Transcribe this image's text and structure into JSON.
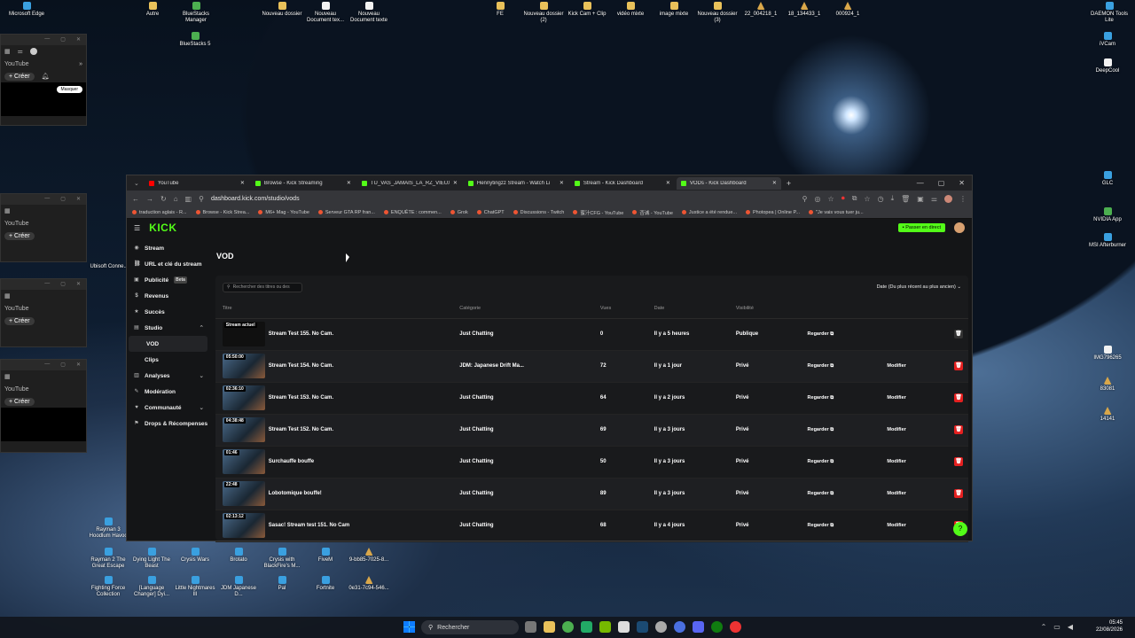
{
  "desktop_icons_top": [
    {
      "label": "Microsoft Edge",
      "type": "app"
    },
    {
      "label": "Autre",
      "type": "folder"
    },
    {
      "label": "BlueStacks Manager",
      "type": "green"
    },
    {
      "label": "Nouveau dossier",
      "type": "folder"
    },
    {
      "label": "Nouveau Document tex...",
      "type": "doc"
    },
    {
      "label": "Nouveau Document texte",
      "type": "doc"
    },
    {
      "label": "FE",
      "type": "folder"
    },
    {
      "label": "Nouveau dossier (2)",
      "type": "folder"
    },
    {
      "label": "Kick Cam + Clip",
      "type": "folder"
    },
    {
      "label": "vidéo mixte",
      "type": "folder"
    },
    {
      "label": "image mixte",
      "type": "folder"
    },
    {
      "label": "Nouveau dossier (3)",
      "type": "folder"
    },
    {
      "label": "22_004218_1",
      "type": "warn"
    },
    {
      "label": "18_134433_1",
      "type": "warn"
    },
    {
      "label": "000924_1",
      "type": "warn"
    },
    {
      "label": "DAEMON Tools Lite",
      "type": "app"
    }
  ],
  "desktop_icons_right": [
    {
      "label": "iVCam",
      "type": "app"
    },
    {
      "label": "DeepCool",
      "type": "doc"
    },
    {
      "label": "GLC",
      "type": "app"
    },
    {
      "label": "NVIDIA App",
      "type": "green"
    },
    {
      "label": "MSI Afterburner",
      "type": "app"
    },
    {
      "label": "IMG796265",
      "type": "doc"
    },
    {
      "label": "83081",
      "type": "warn"
    },
    {
      "label": "14141",
      "type": "warn"
    }
  ],
  "desktop_icons_bottom": [
    {
      "label": "Rayman 3 Hoodlum Havoc",
      "type": "app"
    },
    {
      "label": "Rayman 2 The Great Escape",
      "type": "app"
    },
    {
      "label": "Dying Light The Beast",
      "type": "app"
    },
    {
      "label": "Crysis Wars",
      "type": "app"
    },
    {
      "label": "Brotato",
      "type": "app"
    },
    {
      "label": "Crysis with BlackFire's M...",
      "type": "app"
    },
    {
      "label": "FiveM",
      "type": "app"
    },
    {
      "label": "9-bb85-7025-8...",
      "type": "warn"
    },
    {
      "label": "Fighting Force Collection",
      "type": "app"
    },
    {
      "label": "[Language Changer] Dyi...",
      "type": "app"
    },
    {
      "label": "Little Nightmares III",
      "type": "app"
    },
    {
      "label": "JDM Japanese D...",
      "type": "app"
    },
    {
      "label": "Pal",
      "type": "app"
    },
    {
      "label": "Fortnite",
      "type": "app"
    },
    {
      "label": "0e31-7c94-546...",
      "type": "warn"
    }
  ],
  "desktop_misc": {
    "bluestacks5": "BlueStacks 5",
    "ubisoft": "Ubisoft Conne..."
  },
  "mini_windows": {
    "tab": "YouTube",
    "create": "Créer",
    "hide": "Masquer"
  },
  "browser": {
    "tabs": [
      {
        "label": "YouTube",
        "color": "#ff0000"
      },
      {
        "label": "Browse - Kick Streaming",
        "color": "#53fc18"
      },
      {
        "label": "TU_VAS_JAMAIS_LA_RZ_VIEUX",
        "color": "#53fc18"
      },
      {
        "label": "Hennytingzz Stream - Watch Li",
        "color": "#53fc18"
      },
      {
        "label": "Stream - Kick Dashboard",
        "color": "#53fc18"
      },
      {
        "label": "VODs - Kick Dashboard",
        "color": "#53fc18"
      }
    ],
    "url": "dashboard.kick.com/studio/vods",
    "bookmarks": [
      "traduction aglais - R...",
      "Browse - Kick Strea...",
      "M6+ Mag - YouTube",
      "Serveur GTA RP fran...",
      "ENQUÊTE : commen...",
      "Grok",
      "ChatGPT",
      "Discussions - Twitch",
      "蜜汁CFG - YouTube",
      "否诚 - YouTube",
      "Justice a été rendue...",
      "Photopea | Online P...",
      "\"Je vais vous tuer ju..."
    ]
  },
  "kick": {
    "logo": "KICK",
    "go_live": "Passer en direct",
    "sidebar": [
      {
        "label": "Stream",
        "icon": "◉",
        "active": false,
        "sub": false
      },
      {
        "label": "URL et clé du stream",
        "icon": "⛓",
        "active": false,
        "sub": false
      },
      {
        "label": "Publicité",
        "icon": "▣",
        "active": false,
        "sub": false,
        "badge": "Beta"
      },
      {
        "label": "Revenus",
        "icon": "$",
        "active": false,
        "sub": false
      },
      {
        "label": "Succès",
        "icon": "★",
        "active": false,
        "sub": false
      },
      {
        "label": "Studio",
        "icon": "▤",
        "active": false,
        "sub": false,
        "chev": "⌃"
      },
      {
        "label": "VOD",
        "icon": "",
        "active": true,
        "sub": true
      },
      {
        "label": "Clips",
        "icon": "",
        "active": false,
        "sub": true
      },
      {
        "label": "Analyses",
        "icon": "▥",
        "active": false,
        "sub": false,
        "chev": "⌄"
      },
      {
        "label": "Modération",
        "icon": "✎",
        "active": false,
        "sub": false
      },
      {
        "label": "Communauté",
        "icon": "♥",
        "active": false,
        "sub": false,
        "chev": "⌄"
      },
      {
        "label": "Drops & Récompenses",
        "icon": "⚑",
        "active": false,
        "sub": false
      }
    ],
    "page_title": "VOD",
    "search_placeholder": "Rechercher des titres ou des",
    "sort": "Date (Du plus récent au plus ancien)",
    "columns": [
      "Titre",
      "Catégorie",
      "Vues",
      "Date",
      "Visibilité"
    ],
    "rows": [
      {
        "thumb": "Stream actuel",
        "live": true,
        "title": "Stream Test 155. No Cam.",
        "category": "Just Chatting",
        "views": "0",
        "date": "Il y a 5 heures",
        "visibility": "Publique",
        "watch": "Regarder",
        "edit": "",
        "deletable": false
      },
      {
        "thumb": "05:50:00",
        "live": false,
        "title": "Stream Test 154. No Cam.",
        "category": "JDM: Japanese Drift Ma...",
        "views": "72",
        "date": "Il y a 1 jour",
        "visibility": "Privé",
        "watch": "Regarder",
        "edit": "Modifier",
        "deletable": true
      },
      {
        "thumb": "02:36:10",
        "live": false,
        "title": "Stream Test 153. No Cam.",
        "category": "Just Chatting",
        "views": "64",
        "date": "Il y a 2 jours",
        "visibility": "Privé",
        "watch": "Regarder",
        "edit": "Modifier",
        "deletable": true
      },
      {
        "thumb": "04:38:48",
        "live": false,
        "title": "Stream Test 152. No Cam.",
        "category": "Just Chatting",
        "views": "69",
        "date": "Il y a 3 jours",
        "visibility": "Privé",
        "watch": "Regarder",
        "edit": "Modifier",
        "deletable": true
      },
      {
        "thumb": "01:46",
        "live": false,
        "title": "Surchauffe bouffe",
        "category": "Just Chatting",
        "views": "50",
        "date": "Il y a 3 jours",
        "visibility": "Privé",
        "watch": "Regarder",
        "edit": "Modifier",
        "deletable": true
      },
      {
        "thumb": "22:48",
        "live": false,
        "title": "Lobotomique bouffe!",
        "category": "Just Chatting",
        "views": "89",
        "date": "Il y a 3 jours",
        "visibility": "Privé",
        "watch": "Regarder",
        "edit": "Modifier",
        "deletable": true
      },
      {
        "thumb": "02:13:12",
        "live": false,
        "title": "Sasac! Stream test 151. No Cam",
        "category": "Just Chatting",
        "views": "68",
        "date": "Il y a 4 jours",
        "visibility": "Privé",
        "watch": "Regarder",
        "edit": "Modifier",
        "deletable": true
      }
    ]
  },
  "taskbar": {
    "search": "Rechercher",
    "time": "05:45",
    "date": "22/08/2026"
  }
}
